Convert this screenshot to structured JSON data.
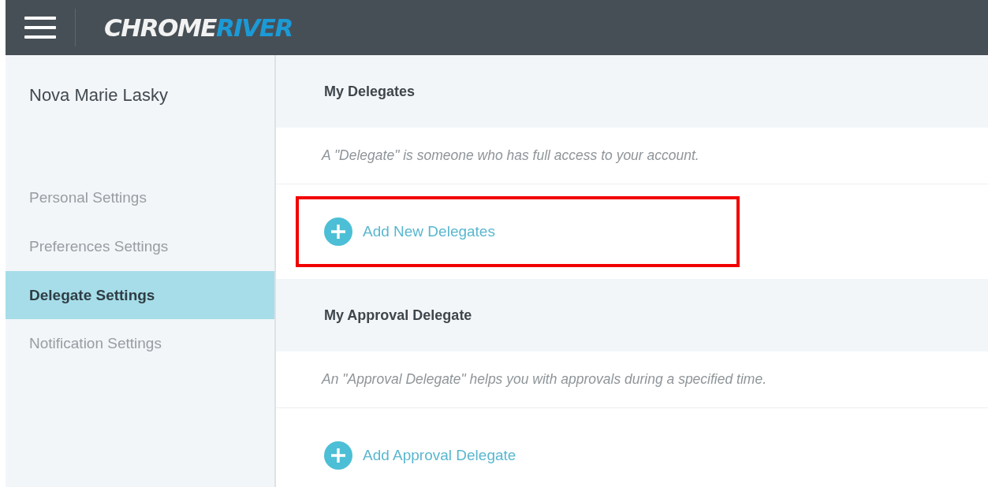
{
  "header": {
    "logo": {
      "primary": "CHROME",
      "accent": "RIVER"
    }
  },
  "sidebar": {
    "user_name": "Nova Marie Lasky",
    "items": [
      {
        "label": "Personal Settings",
        "selected": false
      },
      {
        "label": "Preferences Settings",
        "selected": false
      },
      {
        "label": "Delegate Settings",
        "selected": true
      },
      {
        "label": "Notification Settings",
        "selected": false
      }
    ]
  },
  "sections": [
    {
      "title": "My Delegates",
      "description": "A \"Delegate\" is someone who has full access to your account.",
      "action": "Add New Delegates",
      "highlighted": true
    },
    {
      "title": "My Approval Delegate",
      "description": "An \"Approval Delegate\" helps you with approvals during a specified time.",
      "action": "Add Approval Delegate",
      "highlighted": false
    }
  ]
}
